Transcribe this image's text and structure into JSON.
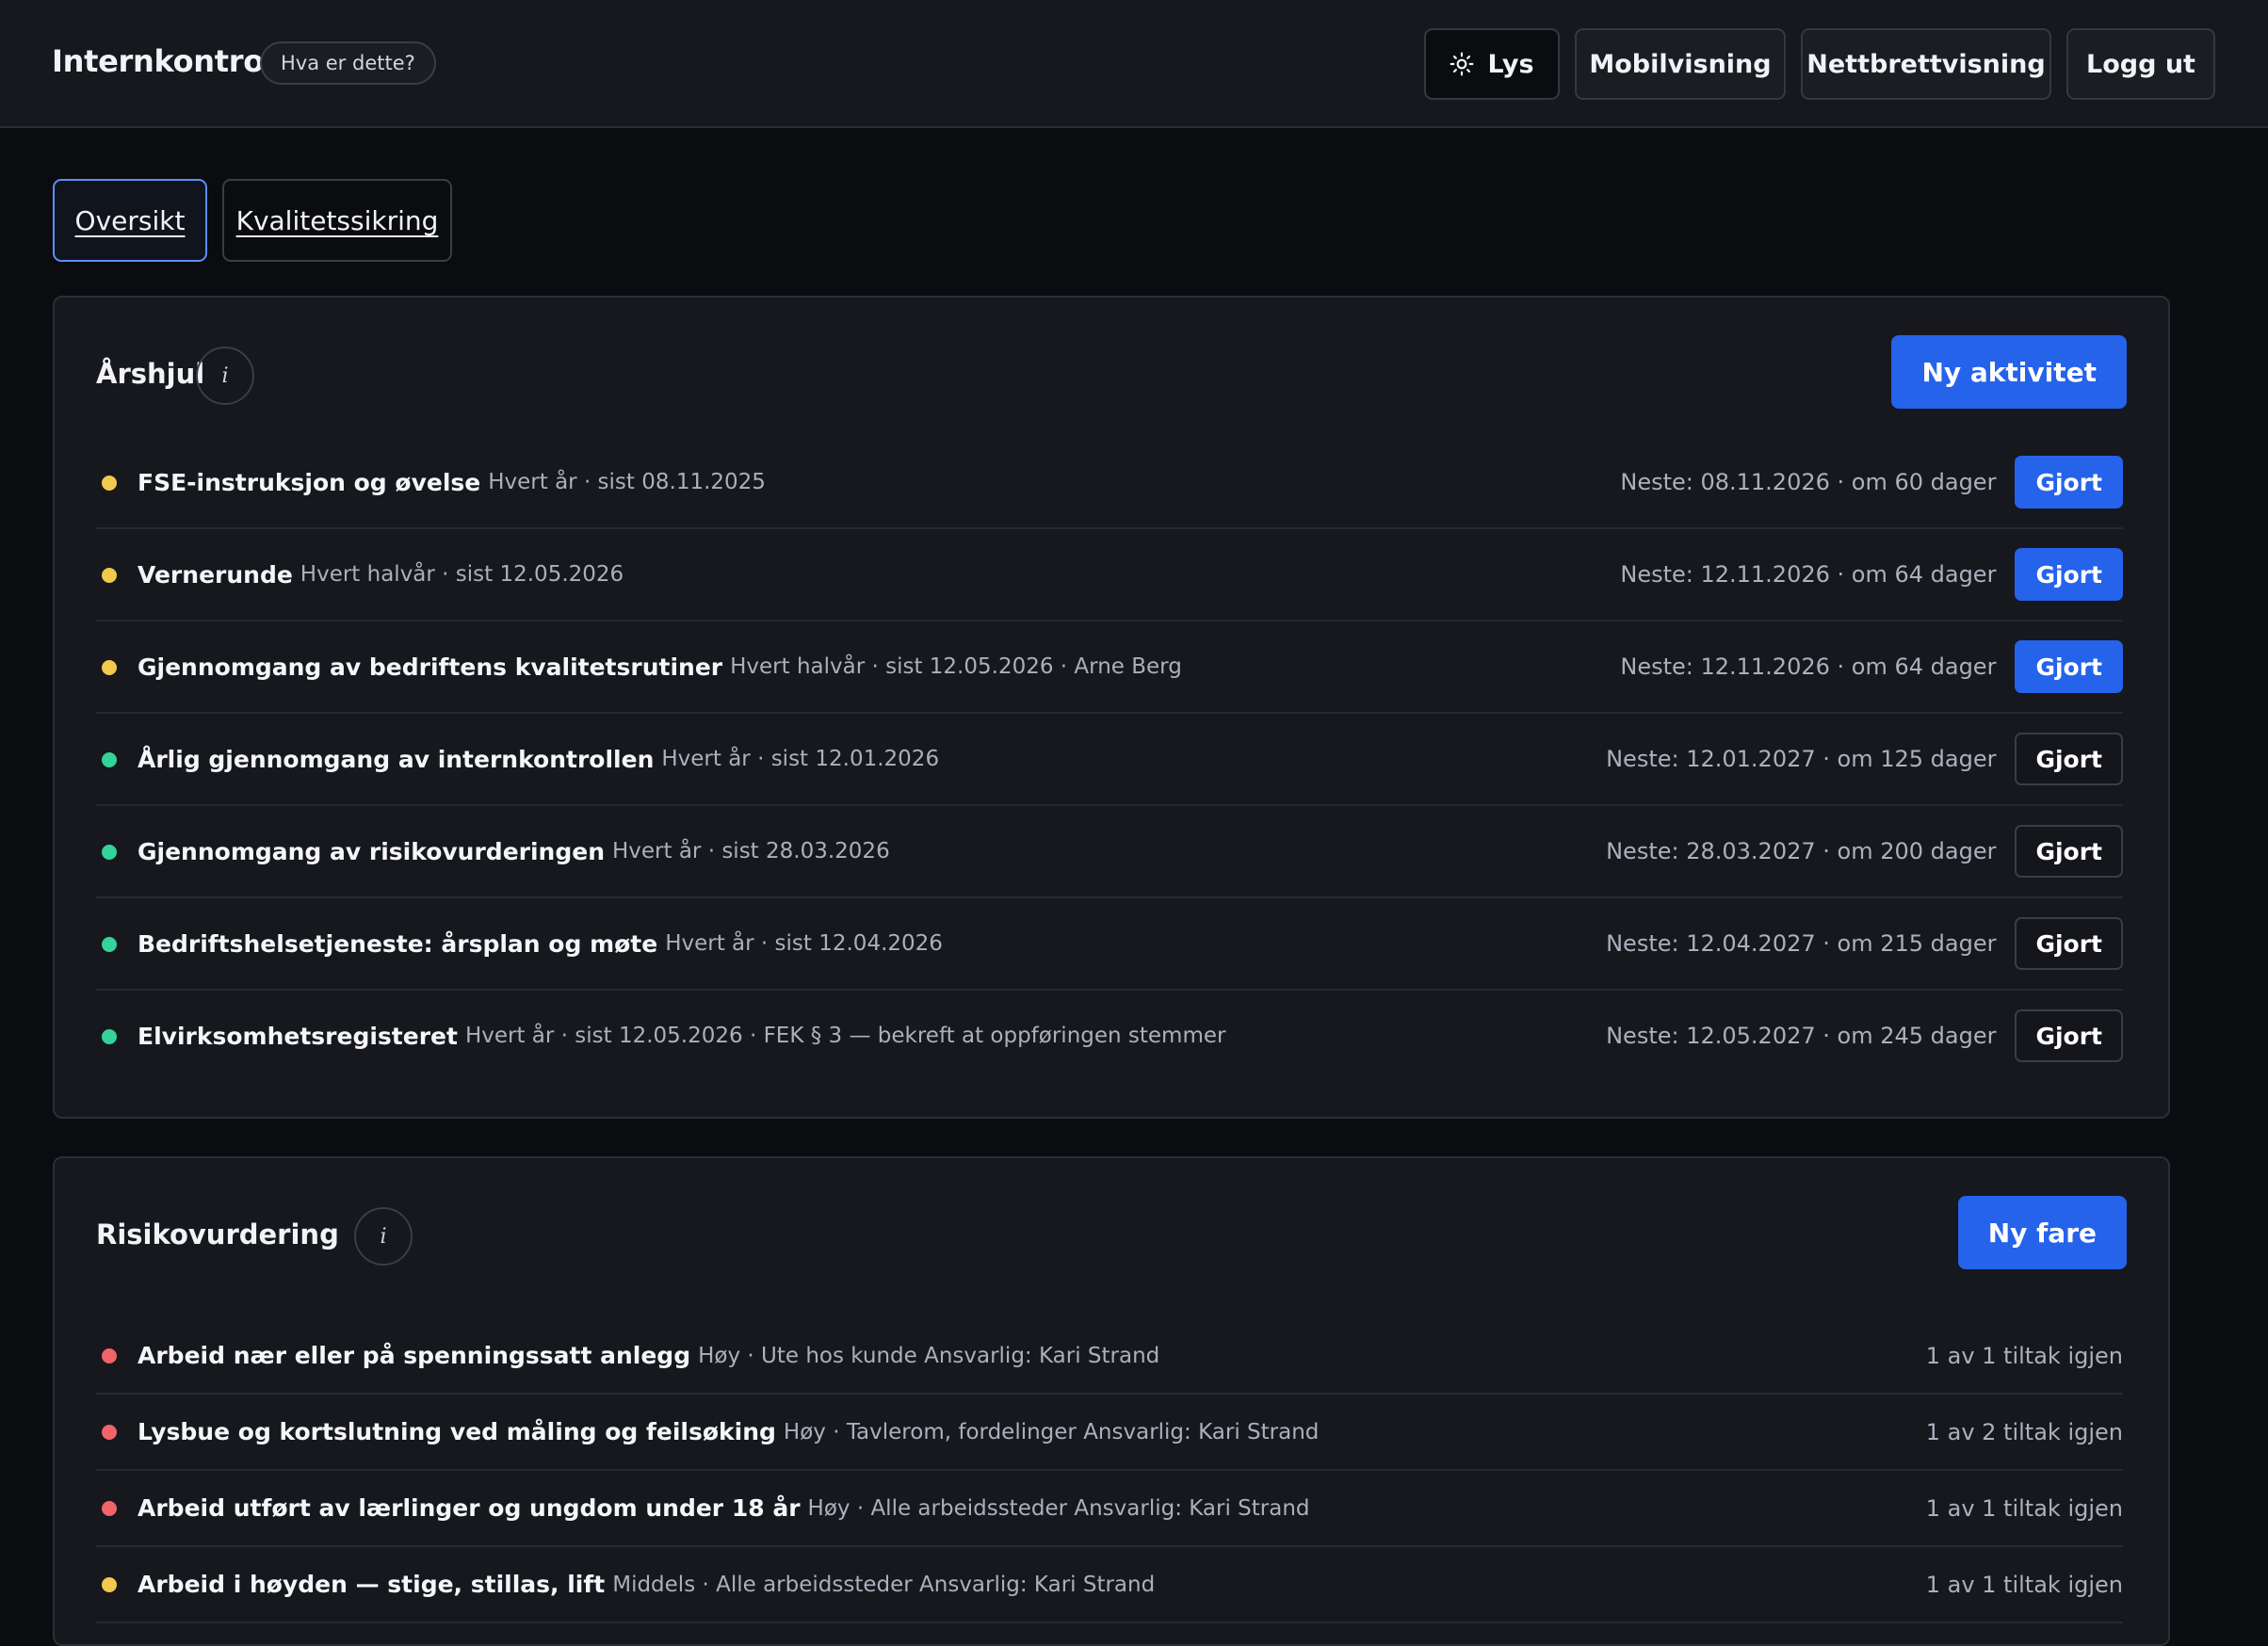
{
  "header": {
    "brand": "Internkontroll",
    "help_label": "Hva er dette?",
    "buttons": {
      "theme": "Lys",
      "mobile": "Mobilvisning",
      "tablet": "Nettbrettvisning",
      "logout": "Logg ut"
    }
  },
  "tabs": [
    {
      "label": "Oversikt",
      "active": true
    },
    {
      "label": "Kvalitetssikring",
      "active": false
    }
  ],
  "arshjul": {
    "title": "Årshjul",
    "info_icon": "i",
    "new_button": "Ny aktivitet",
    "items": [
      {
        "title": "FSE-instruksjon og øvelse",
        "meta": "Hvert år · sist 08.11.2025",
        "next": "Neste: 08.11.2026 · om 60 dager",
        "action": "Gjort",
        "status": "yellow"
      },
      {
        "title": "Vernerunde",
        "meta": "Hvert halvår · sist 12.05.2026",
        "next": "Neste: 12.11.2026 · om 64 dager",
        "action": "Gjort",
        "status": "yellow"
      },
      {
        "title": "Gjennomgang av bedriftens kvalitetsrutiner",
        "meta": "Hvert halvår · sist 12.05.2026 · Arne Berg",
        "next": "Neste: 12.11.2026 · om 64 dager",
        "action": "Gjort",
        "status": "yellow"
      },
      {
        "title": "Årlig gjennomgang av internkontrollen",
        "meta": "Hvert år · sist 12.01.2026",
        "next": "Neste: 12.01.2027 · om 125 dager",
        "action": "Gjort",
        "status": "green"
      },
      {
        "title": "Gjennomgang av risikovurderingen",
        "meta": "Hvert år · sist 28.03.2026",
        "next": "Neste: 28.03.2027 · om 200 dager",
        "action": "Gjort",
        "status": "green"
      },
      {
        "title": "Bedriftshelsetjeneste: årsplan og møte",
        "meta": "Hvert år · sist 12.04.2026",
        "next": "Neste: 12.04.2027 · om 215 dager",
        "action": "Gjort",
        "status": "green"
      },
      {
        "title": "Elvirksomhetsregisteret",
        "meta": "Hvert år · sist 12.05.2026 · FEK § 3 — bekreft at oppføringen stemmer",
        "next": "Neste: 12.05.2027 · om 245 dager",
        "action": "Gjort",
        "status": "green"
      }
    ]
  },
  "risiko": {
    "title": "Risikovurdering",
    "info_icon": "i",
    "new_button": "Ny fare",
    "items": [
      {
        "title": "Arbeid nær eller på spenningssatt anlegg",
        "meta": "Høy · Ute hos kunde Ansvarlig: Kari Strand",
        "count": "1 av 1 tiltak igjen",
        "status": "red"
      },
      {
        "title": "Lysbue og kortslutning ved måling og feilsøking",
        "meta": "Høy · Tavlerom, fordelinger Ansvarlig: Kari Strand",
        "count": "1 av 2 tiltak igjen",
        "status": "red"
      },
      {
        "title": "Arbeid utført av lærlinger og ungdom under 18 år",
        "meta": "Høy · Alle arbeidssteder Ansvarlig: Kari Strand",
        "count": "1 av 1 tiltak igjen",
        "status": "red"
      },
      {
        "title": "Arbeid i høyden — stige, stillas, lift",
        "meta": "Middels · Alle arbeidssteder Ansvarlig: Kari Strand",
        "count": "1 av 1 tiltak igjen",
        "status": "yellow"
      }
    ]
  },
  "colors": {
    "accent": "#2563eb",
    "yellow": "#f2c94c",
    "green": "#34d399",
    "red": "#f0646a"
  },
  "icons": {
    "theme_toggle": "sun-icon",
    "info": "info-icon"
  }
}
